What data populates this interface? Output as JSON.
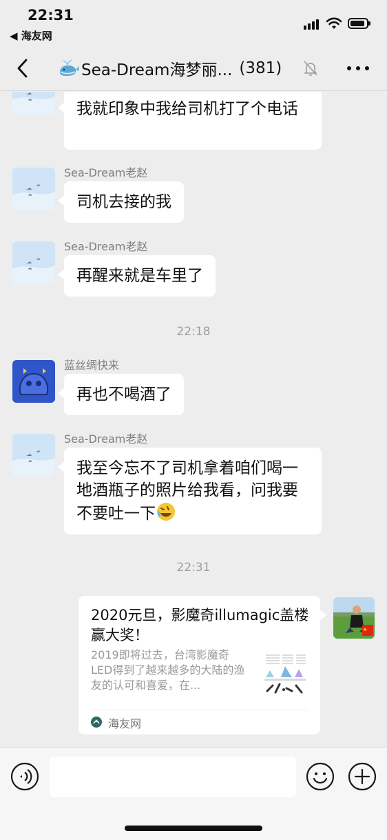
{
  "status_bar": {
    "time": "22:31",
    "back_app": "◀ 海友网",
    "signal_icon": "cellular-signal-icon",
    "wifi_icon": "wifi-icon",
    "battery_icon": "battery-icon"
  },
  "nav": {
    "back_icon": "chevron-left-icon",
    "group_emoji": "whale-emoji",
    "title": "Sea-Dream海梦丽...",
    "member_count": "(381)",
    "mute_icon": "bell-muted-icon",
    "more_icon": "more-dots-icon"
  },
  "messages": [
    {
      "sender": "",
      "text": "我就印象中我给司机打了个电话"
    },
    {
      "sender": "Sea-Dream老赵",
      "text": "司机去接的我"
    },
    {
      "sender": "Sea-Dream老赵",
      "text": "再醒来就是车里了"
    },
    {
      "timestamp": "22:18"
    },
    {
      "sender": "蓝丝绸快来",
      "text": "再也不喝酒了"
    },
    {
      "sender": "Sea-Dream老赵",
      "text": "我至今忘不了司机拿着咱们喝一地酒瓶子的照片给我看，问我要不要吐一下",
      "emoji": "rolling-laughing-emoji"
    },
    {
      "timestamp": "22:31"
    }
  ],
  "link_card": {
    "title": "2020元旦，影魔奇illumagic盖楼赢大奖！",
    "description": "2019即将过去，台湾影魔奇LED得到了越来越多的大陆的渔友的认可和喜爱，在...",
    "source": "海友网",
    "source_icon": "haiyouwang-logo-icon"
  },
  "input_bar": {
    "voice_icon": "voice-input-icon",
    "input_placeholder": "",
    "emoji_icon": "emoji-smile-icon",
    "plus_icon": "plus-circle-icon"
  },
  "colors": {
    "background": "#ededed",
    "bubble": "#ffffff",
    "sender_name": "#7f7f7f",
    "timestamp": "#9e9e9e"
  }
}
